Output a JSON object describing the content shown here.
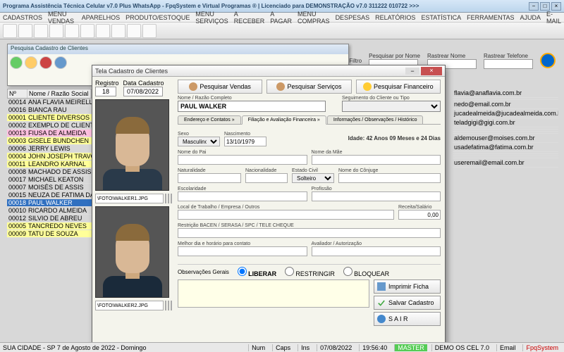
{
  "window": {
    "title": "Programa Assistência Técnica Celular v7.0 Plus WhatsApp - FpqSystem e Virtual Programas ® | Licenciado para  DEMONSTRAÇÃO v7.0 311222 010722 >>>"
  },
  "menu": [
    "CADASTROS",
    "MENU VENDAS",
    "APARELHOS",
    "PRODUTO/ESTOQUE",
    "MENU SERVIÇOS",
    "A RECEBER",
    "A PAGAR",
    "MENU COMPRAS",
    "DESPESAS",
    "RELATÓRIOS",
    "ESTATÍSTICA",
    "FERRAMENTAS",
    "AJUDA",
    "E-MAIL"
  ],
  "search_window": {
    "title": "Pesquisa Cadastro de Clientes"
  },
  "search_top": {
    "tipo": "Tipo do Filtro",
    "nome_lbl": "Pesquisar por Nome",
    "rastrear_nome": "Rastrear Nome",
    "rastrear_tel": "Rastrear Telefone"
  },
  "list": {
    "hdr_num": "Nº",
    "hdr_name": "Nome / Razão Social",
    "rows": [
      {
        "n": "00014",
        "nm": "ANA FLAVIA MEIRELLES",
        "c": ""
      },
      {
        "n": "00016",
        "nm": "BIANCA RAU",
        "c": ""
      },
      {
        "n": "00001",
        "nm": "CLIENTE DIVERSOS",
        "c": "y"
      },
      {
        "n": "00002",
        "nm": "EXEMPLO DE CLIENTE",
        "c": ""
      },
      {
        "n": "00013",
        "nm": "FIUSA DE ALMEIDA",
        "c": "p"
      },
      {
        "n": "00003",
        "nm": "GISELE BUNDCHEN",
        "c": "y"
      },
      {
        "n": "00006",
        "nm": "JERRY LEWIS",
        "c": ""
      },
      {
        "n": "00004",
        "nm": "JOHN JOSEPH TRAVOLTA",
        "c": "y"
      },
      {
        "n": "00011",
        "nm": "LEANDRO KARNAL",
        "c": "y"
      },
      {
        "n": "00008",
        "nm": "MACHADO DE ASSIS",
        "c": ""
      },
      {
        "n": "00017",
        "nm": "MICHAEL KEATON",
        "c": ""
      },
      {
        "n": "00007",
        "nm": "MOISÉS DE ASSIS",
        "c": ""
      },
      {
        "n": "00015",
        "nm": "NEUZA DE FATIMA DA S",
        "c": ""
      },
      {
        "n": "00018",
        "nm": "PAUL WALKER",
        "c": "sel"
      },
      {
        "n": "00010",
        "nm": "RICARDO ALMEIDA",
        "c": ""
      },
      {
        "n": "00012",
        "nm": "SILVIO DE ABREU",
        "c": ""
      },
      {
        "n": "00005",
        "nm": "TANCREDO NEVES",
        "c": "y"
      },
      {
        "n": "00009",
        "nm": "TATU DE SOUZA",
        "c": "y"
      }
    ]
  },
  "emails": [
    "flavia@anaflavia.com.br",
    "",
    "nedo@email.com.br",
    "jucadealmeida@jucadealmeida.com.br",
    "teladgigi@gigi.com.br",
    "",
    "",
    "",
    "aldemouser@moises.com.br",
    "usadefatima@fatima.com.br",
    "",
    "",
    "",
    "useremail@email.com.br"
  ],
  "dialog": {
    "title": "Tela Cadastro de Clientes",
    "registro_lbl": "Registro",
    "registro": "18",
    "datacad_lbl": "Data Cadastro",
    "datacad": "07/08/2022",
    "photo1": "\\FOTO\\WALKER1.JPG",
    "photo2": "\\FOTO\\WALKER2.JPG",
    "btn_vendas": "Pesquisar Vendas",
    "btn_servicos": "Pesquisar Serviços",
    "btn_financ": "Pesquisar Financeiro",
    "nome_lbl": "Nome / Razão Completo",
    "nome": "PAUL WALKER",
    "seg_lbl": "Seguimento do Cliente ou Tipo",
    "tabs": [
      "Endereço e Contatos  »",
      "Filiação e Avaliação Financeira  »",
      "Informações / Observações / Histórico"
    ],
    "sexo_lbl": "Sexo",
    "sexo": "Masculino",
    "nasc_lbl": "Nascimento",
    "nasc": "13/10/1979",
    "idade": "Idade: 42 Anos 09 Meses e 24 Dias",
    "pai_lbl": "Nome do Pai",
    "mae_lbl": "Nome da Mãe",
    "nat_lbl": "Naturalidade",
    "nac_lbl": "Nacionalidade",
    "ecivil_lbl": "Estado Civil",
    "ecivil": "Solteiro",
    "conj_lbl": "Nome do Cônjuge",
    "esc_lbl": "Escolaridade",
    "prof_lbl": "Profissão",
    "trab_lbl": "Local de Trabalho / Empresa / Outros",
    "sal_lbl": "Receita/Salário",
    "sal": "0,00",
    "restr_lbl": "Restrição BACEN / SERASA / SPC / TELE CHEQUE",
    "horario_lbl": "Melhor dia e horário para contato",
    "avaliador_lbl": "Avaliador / Autorização",
    "obs_lbl": "Observações Gerais",
    "opt_liberar": "LIBERAR",
    "opt_restringir": "RESTRINGIR",
    "opt_bloquear": "BLOQUEAR",
    "btn_imprimir": "Imprimir Ficha",
    "btn_salvar": "Salvar Cadastro",
    "btn_sair": "S A I R"
  },
  "status": {
    "local": "SUA CIDADE - SP  7 de Agosto de 2022 - Domingo",
    "num": "Num",
    "caps": "Caps",
    "ins": "Ins",
    "date": "07/08/2022",
    "time": "19:56:40",
    "master": "MASTER",
    "demo": "DEMO OS CEL 7.0",
    "email": "Email",
    "brand": "FpqSystem"
  }
}
